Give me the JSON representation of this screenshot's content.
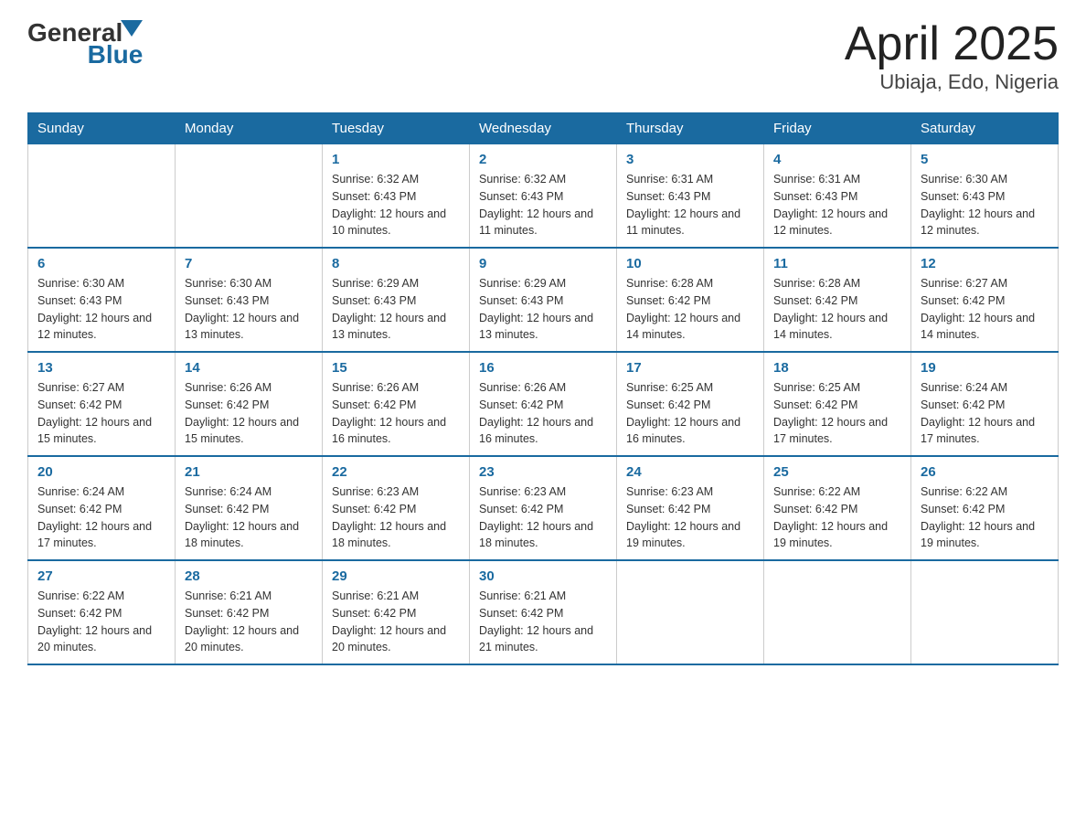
{
  "header": {
    "logo_general": "General",
    "logo_blue": "Blue",
    "title": "April 2025",
    "subtitle": "Ubiaja, Edo, Nigeria"
  },
  "weekdays": [
    "Sunday",
    "Monday",
    "Tuesday",
    "Wednesday",
    "Thursday",
    "Friday",
    "Saturday"
  ],
  "weeks": [
    [
      {
        "day": "",
        "info": ""
      },
      {
        "day": "",
        "info": ""
      },
      {
        "day": "1",
        "info": "Sunrise: 6:32 AM\nSunset: 6:43 PM\nDaylight: 12 hours and 10 minutes."
      },
      {
        "day": "2",
        "info": "Sunrise: 6:32 AM\nSunset: 6:43 PM\nDaylight: 12 hours and 11 minutes."
      },
      {
        "day": "3",
        "info": "Sunrise: 6:31 AM\nSunset: 6:43 PM\nDaylight: 12 hours and 11 minutes."
      },
      {
        "day": "4",
        "info": "Sunrise: 6:31 AM\nSunset: 6:43 PM\nDaylight: 12 hours and 12 minutes."
      },
      {
        "day": "5",
        "info": "Sunrise: 6:30 AM\nSunset: 6:43 PM\nDaylight: 12 hours and 12 minutes."
      }
    ],
    [
      {
        "day": "6",
        "info": "Sunrise: 6:30 AM\nSunset: 6:43 PM\nDaylight: 12 hours and 12 minutes."
      },
      {
        "day": "7",
        "info": "Sunrise: 6:30 AM\nSunset: 6:43 PM\nDaylight: 12 hours and 13 minutes."
      },
      {
        "day": "8",
        "info": "Sunrise: 6:29 AM\nSunset: 6:43 PM\nDaylight: 12 hours and 13 minutes."
      },
      {
        "day": "9",
        "info": "Sunrise: 6:29 AM\nSunset: 6:43 PM\nDaylight: 12 hours and 13 minutes."
      },
      {
        "day": "10",
        "info": "Sunrise: 6:28 AM\nSunset: 6:42 PM\nDaylight: 12 hours and 14 minutes."
      },
      {
        "day": "11",
        "info": "Sunrise: 6:28 AM\nSunset: 6:42 PM\nDaylight: 12 hours and 14 minutes."
      },
      {
        "day": "12",
        "info": "Sunrise: 6:27 AM\nSunset: 6:42 PM\nDaylight: 12 hours and 14 minutes."
      }
    ],
    [
      {
        "day": "13",
        "info": "Sunrise: 6:27 AM\nSunset: 6:42 PM\nDaylight: 12 hours and 15 minutes."
      },
      {
        "day": "14",
        "info": "Sunrise: 6:26 AM\nSunset: 6:42 PM\nDaylight: 12 hours and 15 minutes."
      },
      {
        "day": "15",
        "info": "Sunrise: 6:26 AM\nSunset: 6:42 PM\nDaylight: 12 hours and 16 minutes."
      },
      {
        "day": "16",
        "info": "Sunrise: 6:26 AM\nSunset: 6:42 PM\nDaylight: 12 hours and 16 minutes."
      },
      {
        "day": "17",
        "info": "Sunrise: 6:25 AM\nSunset: 6:42 PM\nDaylight: 12 hours and 16 minutes."
      },
      {
        "day": "18",
        "info": "Sunrise: 6:25 AM\nSunset: 6:42 PM\nDaylight: 12 hours and 17 minutes."
      },
      {
        "day": "19",
        "info": "Sunrise: 6:24 AM\nSunset: 6:42 PM\nDaylight: 12 hours and 17 minutes."
      }
    ],
    [
      {
        "day": "20",
        "info": "Sunrise: 6:24 AM\nSunset: 6:42 PM\nDaylight: 12 hours and 17 minutes."
      },
      {
        "day": "21",
        "info": "Sunrise: 6:24 AM\nSunset: 6:42 PM\nDaylight: 12 hours and 18 minutes."
      },
      {
        "day": "22",
        "info": "Sunrise: 6:23 AM\nSunset: 6:42 PM\nDaylight: 12 hours and 18 minutes."
      },
      {
        "day": "23",
        "info": "Sunrise: 6:23 AM\nSunset: 6:42 PM\nDaylight: 12 hours and 18 minutes."
      },
      {
        "day": "24",
        "info": "Sunrise: 6:23 AM\nSunset: 6:42 PM\nDaylight: 12 hours and 19 minutes."
      },
      {
        "day": "25",
        "info": "Sunrise: 6:22 AM\nSunset: 6:42 PM\nDaylight: 12 hours and 19 minutes."
      },
      {
        "day": "26",
        "info": "Sunrise: 6:22 AM\nSunset: 6:42 PM\nDaylight: 12 hours and 19 minutes."
      }
    ],
    [
      {
        "day": "27",
        "info": "Sunrise: 6:22 AM\nSunset: 6:42 PM\nDaylight: 12 hours and 20 minutes."
      },
      {
        "day": "28",
        "info": "Sunrise: 6:21 AM\nSunset: 6:42 PM\nDaylight: 12 hours and 20 minutes."
      },
      {
        "day": "29",
        "info": "Sunrise: 6:21 AM\nSunset: 6:42 PM\nDaylight: 12 hours and 20 minutes."
      },
      {
        "day": "30",
        "info": "Sunrise: 6:21 AM\nSunset: 6:42 PM\nDaylight: 12 hours and 21 minutes."
      },
      {
        "day": "",
        "info": ""
      },
      {
        "day": "",
        "info": ""
      },
      {
        "day": "",
        "info": ""
      }
    ]
  ]
}
